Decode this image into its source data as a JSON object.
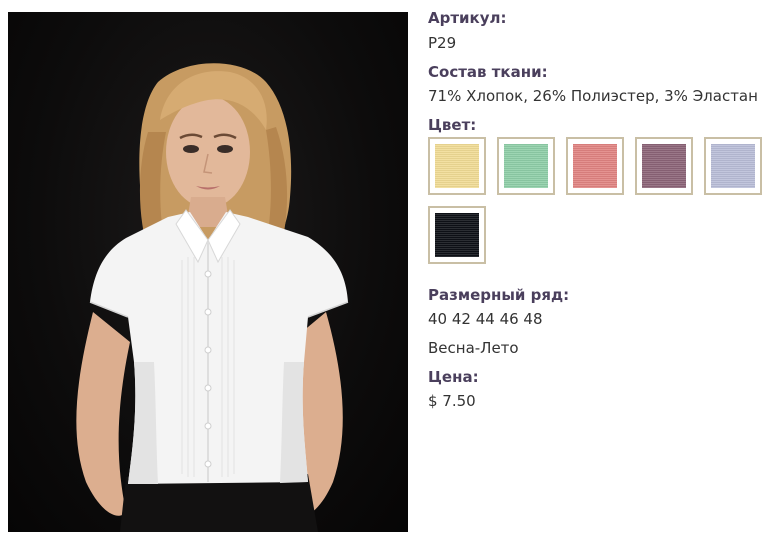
{
  "product": {
    "photo_alt": "",
    "sku_label": "Артикул:",
    "sku_value": "P29",
    "fabric_label": "Состав ткани:",
    "fabric_value": "71% Хлопок, 26% Полиэстер, 3% Эластан",
    "color_label": "Цвет:",
    "colors": [
      {
        "name": "yellow-swatch",
        "hex": "#f1dc95"
      },
      {
        "name": "mint-swatch",
        "hex": "#8fcfa8"
      },
      {
        "name": "coral-swatch",
        "hex": "#e18482"
      },
      {
        "name": "mauve-swatch",
        "hex": "#8c6478"
      },
      {
        "name": "lavender-swatch",
        "hex": "#b9bed8"
      },
      {
        "name": "black-swatch",
        "hex": "#0e1117"
      }
    ],
    "size_label": "Размерный ряд:",
    "size_value": "40 42 44 46 48",
    "season_value": "Весна-Лето",
    "price_label": "Цена:",
    "price_value": "$ 7.50"
  },
  "colors": {
    "label": "#4a3f5c",
    "text": "#333333",
    "swatch_border": "#c9bfa5",
    "photo_background": "#0d0c0c"
  }
}
